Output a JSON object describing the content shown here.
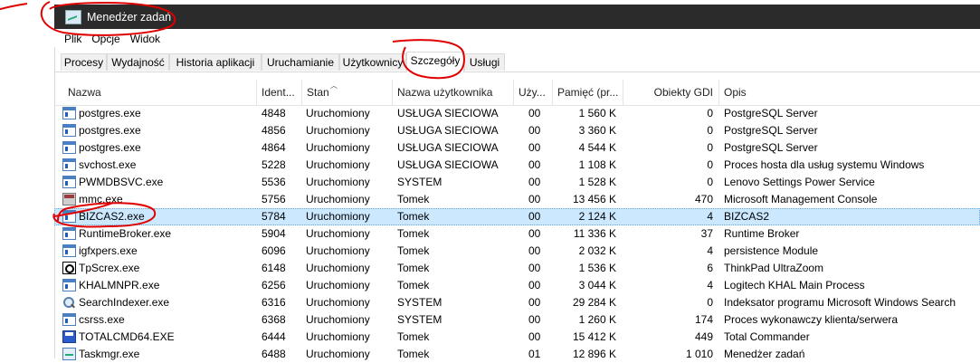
{
  "window": {
    "title": "Menedżer zadań",
    "app_icon": "task-manager-icon"
  },
  "menu": [
    "Plik",
    "Opcje",
    "Widok"
  ],
  "tabs": [
    {
      "label": "Procesy"
    },
    {
      "label": "Wydajność"
    },
    {
      "label": "Historia aplikacji"
    },
    {
      "label": "Uruchamianie"
    },
    {
      "label": "Użytkownicy"
    },
    {
      "label": "Szczegóły",
      "active": true
    },
    {
      "label": "Usługi"
    }
  ],
  "columns": [
    "Nazwa",
    "Ident...",
    "Stan",
    "Nazwa użytkownika",
    "Uży...",
    "Pamięć (pr...",
    "Obiekty GDI",
    "Opis"
  ],
  "rows": [
    {
      "name": "postgres.exe",
      "pid": "4848",
      "status": "Uruchomiony",
      "user": "USŁUGA SIECIOWA",
      "cpu": "00",
      "mem": "1 560 K",
      "gdi": "0",
      "desc": "PostgreSQL Server",
      "icon": "exe-icon"
    },
    {
      "name": "postgres.exe",
      "pid": "4856",
      "status": "Uruchomiony",
      "user": "USŁUGA SIECIOWA",
      "cpu": "00",
      "mem": "3 360 K",
      "gdi": "0",
      "desc": "PostgreSQL Server",
      "icon": "exe-icon"
    },
    {
      "name": "postgres.exe",
      "pid": "4864",
      "status": "Uruchomiony",
      "user": "USŁUGA SIECIOWA",
      "cpu": "00",
      "mem": "4 544 K",
      "gdi": "0",
      "desc": "PostgreSQL Server",
      "icon": "exe-icon"
    },
    {
      "name": "svchost.exe",
      "pid": "5228",
      "status": "Uruchomiony",
      "user": "USŁUGA SIECIOWA",
      "cpu": "00",
      "mem": "1 108 K",
      "gdi": "0",
      "desc": "Proces hosta dla usług systemu Windows",
      "icon": "exe-icon"
    },
    {
      "name": "PWMDBSVC.exe",
      "pid": "5536",
      "status": "Uruchomiony",
      "user": "SYSTEM",
      "cpu": "00",
      "mem": "1 528 K",
      "gdi": "0",
      "desc": "Lenovo Settings Power Service",
      "icon": "exe-icon"
    },
    {
      "name": "mmc.exe",
      "pid": "5756",
      "status": "Uruchomiony",
      "user": "Tomek",
      "cpu": "00",
      "mem": "13 456 K",
      "gdi": "470",
      "desc": "Microsoft Management Console",
      "icon": "mmc-icon"
    },
    {
      "name": "BIZCAS2.exe",
      "pid": "5784",
      "status": "Uruchomiony",
      "user": "Tomek",
      "cpu": "00",
      "mem": "2 124 K",
      "gdi": "4",
      "desc": "BIZCAS2",
      "icon": "exe-icon",
      "selected": true
    },
    {
      "name": "RuntimeBroker.exe",
      "pid": "5904",
      "status": "Uruchomiony",
      "user": "Tomek",
      "cpu": "00",
      "mem": "11 336 K",
      "gdi": "37",
      "desc": "Runtime Broker",
      "icon": "exe-icon"
    },
    {
      "name": "igfxpers.exe",
      "pid": "6096",
      "status": "Uruchomiony",
      "user": "Tomek",
      "cpu": "00",
      "mem": "2 032 K",
      "gdi": "4",
      "desc": "persistence Module",
      "icon": "exe-icon"
    },
    {
      "name": "TpScrex.exe",
      "pid": "6148",
      "status": "Uruchomiony",
      "user": "Tomek",
      "cpu": "00",
      "mem": "1 536 K",
      "gdi": "6",
      "desc": "ThinkPad UltraZoom",
      "icon": "zoom-icon"
    },
    {
      "name": "KHALMNPR.exe",
      "pid": "6256",
      "status": "Uruchomiony",
      "user": "Tomek",
      "cpu": "00",
      "mem": "3 044 K",
      "gdi": "4",
      "desc": "Logitech KHAL Main Process",
      "icon": "exe-icon"
    },
    {
      "name": "SearchIndexer.exe",
      "pid": "6316",
      "status": "Uruchomiony",
      "user": "SYSTEM",
      "cpu": "00",
      "mem": "29 284 K",
      "gdi": "0",
      "desc": "Indeksator programu Microsoft Windows Search",
      "icon": "search-icon"
    },
    {
      "name": "csrss.exe",
      "pid": "6368",
      "status": "Uruchomiony",
      "user": "SYSTEM",
      "cpu": "00",
      "mem": "1 260 K",
      "gdi": "174",
      "desc": "Proces wykonawczy klienta/serwera",
      "icon": "exe-icon"
    },
    {
      "name": "TOTALCMD64.EXE",
      "pid": "6444",
      "status": "Uruchomiony",
      "user": "Tomek",
      "cpu": "00",
      "mem": "15 412 K",
      "gdi": "449",
      "desc": "Total Commander",
      "icon": "disk-icon"
    },
    {
      "name": "Taskmgr.exe",
      "pid": "6488",
      "status": "Uruchomiony",
      "user": "Tomek",
      "cpu": "01",
      "mem": "12 896 K",
      "gdi": "1 010",
      "desc": "Menedżer zadań",
      "icon": "task-manager-icon"
    }
  ]
}
